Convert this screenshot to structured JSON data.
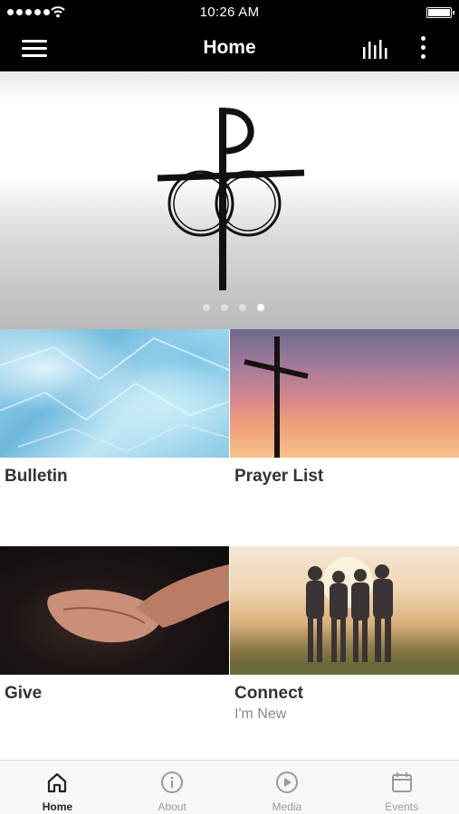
{
  "status_bar": {
    "time": "10:26 AM"
  },
  "nav": {
    "title": "Home"
  },
  "hero": {
    "slide_count": 4,
    "active_slide": 4
  },
  "tiles": [
    {
      "title": "Bulletin",
      "subtitle": ""
    },
    {
      "title": "Prayer List",
      "subtitle": ""
    },
    {
      "title": "Give",
      "subtitle": ""
    },
    {
      "title": "Connect",
      "subtitle": "I'm New"
    }
  ],
  "tabs": [
    {
      "label": "Home",
      "icon": "home-icon",
      "active": true
    },
    {
      "label": "About",
      "icon": "info-icon",
      "active": false
    },
    {
      "label": "Media",
      "icon": "play-circle-icon",
      "active": false
    },
    {
      "label": "Events",
      "icon": "calendar-icon",
      "active": false
    }
  ],
  "colors": {
    "bar_background": "#000000",
    "tab_active": "#222222",
    "tab_inactive": "#9a9a9a"
  }
}
